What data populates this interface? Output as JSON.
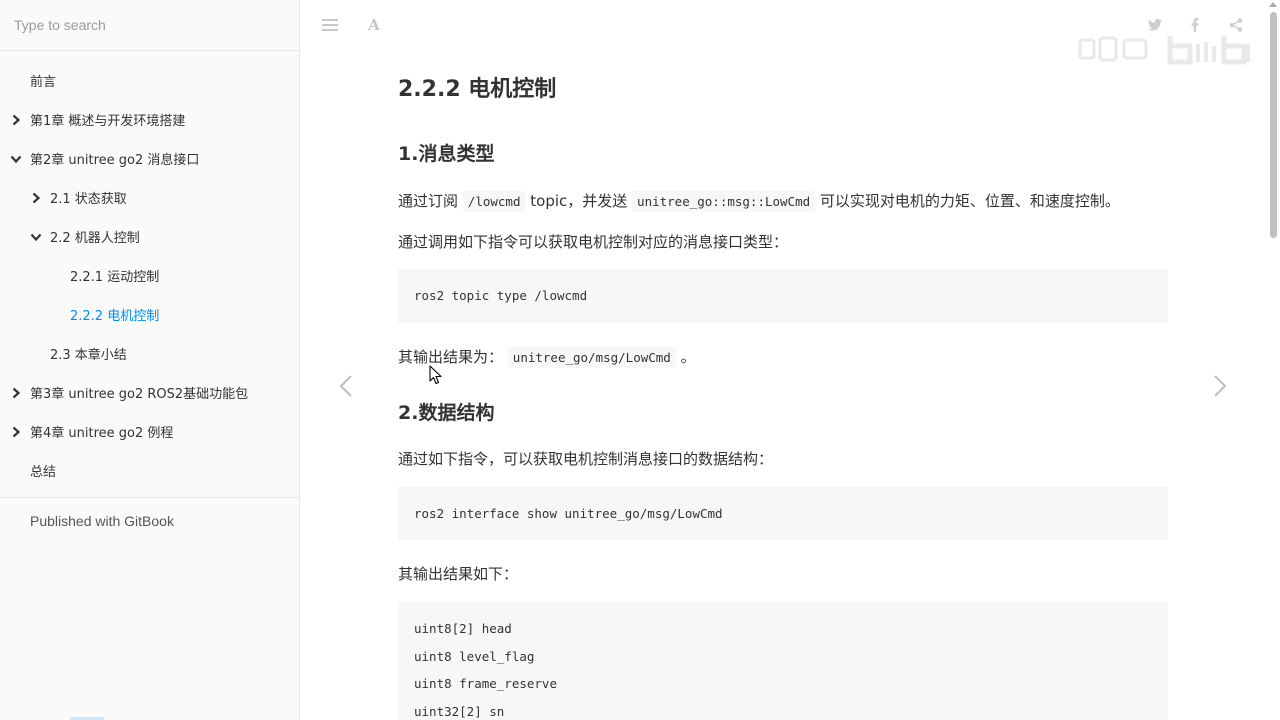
{
  "search": {
    "placeholder": "Type to search"
  },
  "sidebar": {
    "items": [
      {
        "label": "前言",
        "level": 0,
        "chevron": "none",
        "active": false
      },
      {
        "label": "第1章 概述与开发环境搭建",
        "level": 0,
        "chevron": "right",
        "active": false
      },
      {
        "label": "第2章 unitree go2 消息接口",
        "level": 0,
        "chevron": "down",
        "active": false
      },
      {
        "label": "2.1 状态获取",
        "level": 1,
        "chevron": "right",
        "active": false
      },
      {
        "label": "2.2 机器人控制",
        "level": 1,
        "chevron": "down",
        "active": false
      },
      {
        "label": "2.2.1 运动控制",
        "level": 2,
        "chevron": "none",
        "active": false
      },
      {
        "label": "2.2.2 电机控制",
        "level": 2,
        "chevron": "none",
        "active": true
      },
      {
        "label": "2.3 本章小结",
        "level": 1,
        "chevron": "none",
        "active": false
      },
      {
        "label": "第3章 unitree go2 ROS2基础功能包",
        "level": 0,
        "chevron": "right",
        "active": false
      },
      {
        "label": "第4章 unitree go2 例程",
        "level": 0,
        "chevron": "right",
        "active": false
      },
      {
        "label": "总结",
        "level": 0,
        "chevron": "none",
        "active": false
      }
    ],
    "published": "Published with GitBook"
  },
  "toolbar": {
    "font_label": "A",
    "icons": [
      "menu-icon",
      "font-settings-icon",
      "twitter-icon",
      "facebook-icon",
      "share-icon"
    ]
  },
  "content": {
    "title": "2.2.2 电机控制",
    "section1": {
      "heading": "1.消息类型",
      "p1": {
        "pre": "通过订阅",
        "code1": "/lowcmd",
        "mid": "topic，并发送",
        "code2": "unitree_go::msg::LowCmd",
        "post": "可以实现对电机的力矩、位置、和速度控制。"
      },
      "p2": "通过调用如下指令可以获取电机控制对应的消息接口类型：",
      "code": [
        "ros2 topic type /lowcmd"
      ],
      "p3": {
        "pre": "其输出结果为：",
        "code": "unitree_go/msg/LowCmd",
        "post": "。"
      }
    },
    "section2": {
      "heading": "2.数据结构",
      "p1": "通过如下指令，可以获取电机控制消息接口的数据结构：",
      "code": [
        "ros2 interface show unitree_go/msg/LowCmd"
      ],
      "p2": "其输出结果如下：",
      "output": [
        "uint8[2] head",
        "uint8 level_flag",
        "uint8 frame_reserve",
        "uint32[2] sn"
      ]
    }
  },
  "colors": {
    "active_link": "#008cff",
    "sidebar_bg": "#fafafa",
    "code_bg": "#f7f7f7"
  }
}
